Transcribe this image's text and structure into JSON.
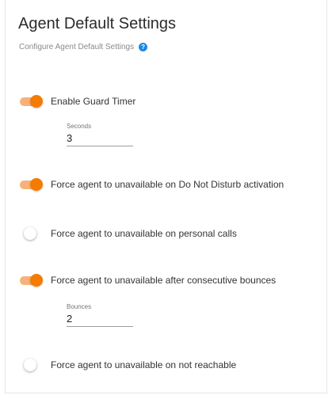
{
  "header": {
    "title": "Agent Default Settings",
    "subtitle": "Configure Agent Default Settings"
  },
  "icons": {
    "help": "help-icon"
  },
  "colors": {
    "toggle_on_knob": "#f57c00",
    "toggle_on_track": "#f7b27a",
    "help_icon": "#1e88e5"
  },
  "settings": [
    {
      "label": "Enable Guard Timer",
      "enabled": true
    },
    {
      "label": "Force agent to unavailable on Do Not Disturb activation",
      "enabled": true
    },
    {
      "label": "Force agent to unavailable on personal calls",
      "enabled": false
    },
    {
      "label": "Force agent to unavailable after consecutive bounces",
      "enabled": true
    },
    {
      "label": "Force agent to unavailable on not reachable",
      "enabled": false
    }
  ],
  "fields": {
    "seconds": {
      "label": "Seconds",
      "value": "3"
    },
    "bounces": {
      "label": "Bounces",
      "value": "2"
    }
  }
}
